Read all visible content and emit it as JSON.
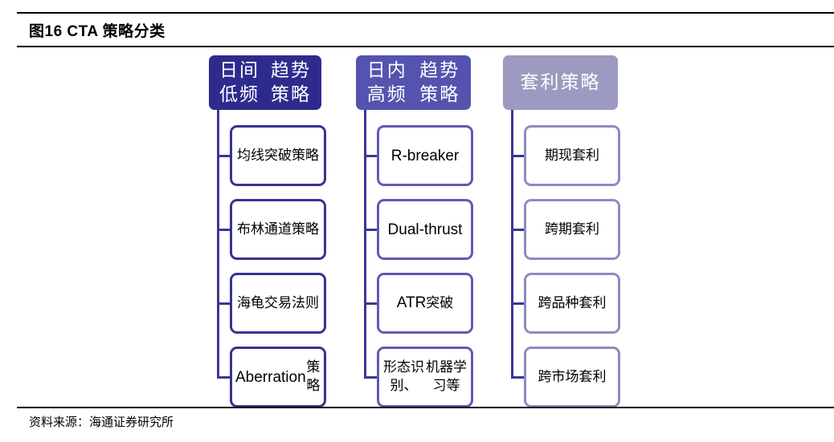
{
  "figure": {
    "title": "图16 CTA 策略分类",
    "source": "资料来源：海通证券研究所"
  },
  "columns": [
    {
      "heading": "日间低频\n趋势策略",
      "color": "#2e2b8e",
      "items": [
        "均线突破策\n略",
        "布林通道策\n略",
        "海龟交易法\n则",
        "Aberration\n策略"
      ]
    },
    {
      "heading": "日内高频\n趋势策略",
      "color": "#5454b0",
      "items": [
        "R-breaker",
        "Dual-thrust",
        "ATR突破",
        "形态识别、\n机器学习等"
      ]
    },
    {
      "heading": "套利策略",
      "color": "#9c9ac0",
      "items": [
        "期现套利",
        "跨期套利",
        "跨品种套利",
        "跨市场套利"
      ]
    }
  ]
}
